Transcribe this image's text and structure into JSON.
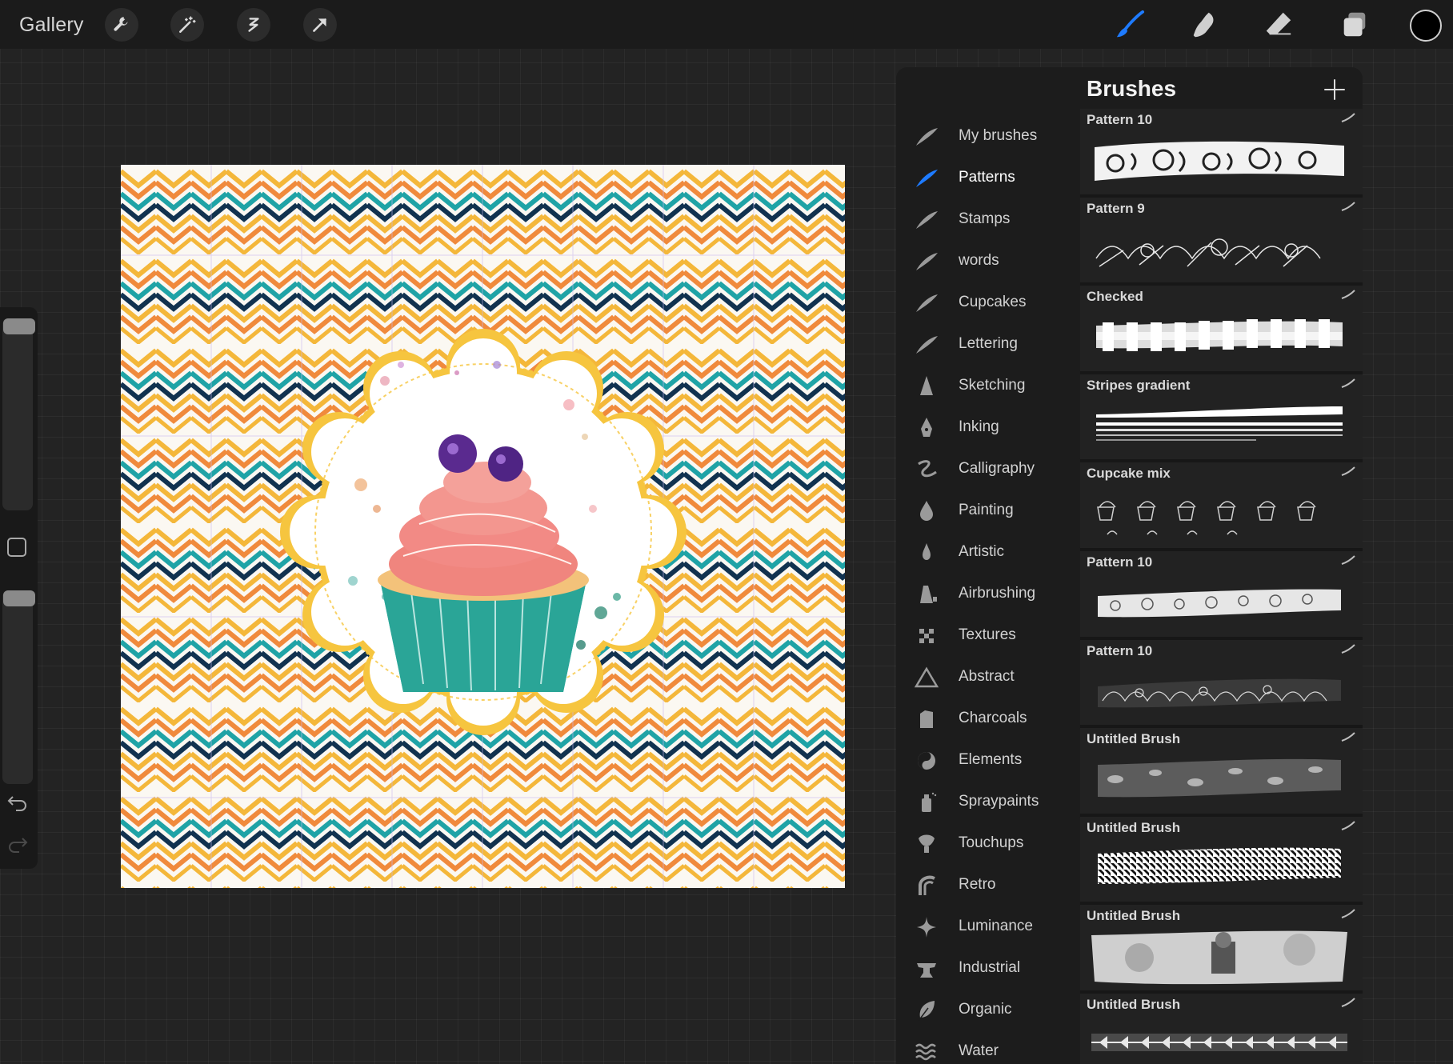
{
  "topbar": {
    "gallery_label": "Gallery",
    "left_tools": [
      "wrench-icon",
      "magic-wand-icon",
      "selection-icon",
      "transform-arrow-icon"
    ],
    "right_tools": [
      "brush-icon",
      "smudge-icon",
      "eraser-icon",
      "layers-icon"
    ],
    "active_tool": "brush-icon",
    "current_color": "#000000"
  },
  "colors": {
    "accent": "#1e7bff",
    "panel": "#1c1c1c",
    "background": "#232323"
  },
  "canvas": {
    "subject": "watercolor cupcake on scalloped label over zigzag chevron pattern",
    "pattern_colors": [
      "#f4b73a",
      "#f08a3c",
      "#1fa3a6",
      "#11324f"
    ]
  },
  "brush_panel": {
    "title": "Brushes",
    "add_icon": "plus-icon",
    "active_set": "Patterns",
    "sets": [
      {
        "label": "My brushes",
        "icon": "feather-icon"
      },
      {
        "label": "Patterns",
        "icon": "feather-icon"
      },
      {
        "label": "Stamps",
        "icon": "feather-icon"
      },
      {
        "label": "words",
        "icon": "feather-icon"
      },
      {
        "label": "Cupcakes",
        "icon": "feather-icon"
      },
      {
        "label": "Lettering",
        "icon": "feather-icon"
      },
      {
        "label": "Sketching",
        "icon": "pencil-tip-icon"
      },
      {
        "label": "Inking",
        "icon": "pen-nib-icon"
      },
      {
        "label": "Calligraphy",
        "icon": "calligraphy-icon"
      },
      {
        "label": "Painting",
        "icon": "paint-drop-icon"
      },
      {
        "label": "Artistic",
        "icon": "flame-drop-icon"
      },
      {
        "label": "Airbrushing",
        "icon": "airbrush-icon"
      },
      {
        "label": "Textures",
        "icon": "checker-icon"
      },
      {
        "label": "Abstract",
        "icon": "triangle-icon"
      },
      {
        "label": "Charcoals",
        "icon": "charcoal-icon"
      },
      {
        "label": "Elements",
        "icon": "yin-yang-icon"
      },
      {
        "label": "Spraypaints",
        "icon": "spray-can-icon"
      },
      {
        "label": "Touchups",
        "icon": "touchup-icon"
      },
      {
        "label": "Retro",
        "icon": "rainbow-icon"
      },
      {
        "label": "Luminance",
        "icon": "sparkle-icon"
      },
      {
        "label": "Industrial",
        "icon": "anvil-icon"
      },
      {
        "label": "Organic",
        "icon": "leaf-icon"
      },
      {
        "label": "Water",
        "icon": "waves-icon"
      }
    ],
    "brushes": [
      {
        "name": "Pattern 10",
        "preview": "swirl"
      },
      {
        "name": "Pattern 9",
        "preview": "doodle"
      },
      {
        "name": "Checked",
        "preview": "checked"
      },
      {
        "name": "Stripes gradient",
        "preview": "stripes"
      },
      {
        "name": "Cupcake mix",
        "preview": "cupcakes"
      },
      {
        "name": "Pattern 10",
        "preview": "lace"
      },
      {
        "name": "Pattern 10",
        "preview": "dark-lace"
      },
      {
        "name": "Untitled Brush",
        "preview": "floral"
      },
      {
        "name": "Untitled Brush",
        "preview": "houndstooth"
      },
      {
        "name": "Untitled Brush",
        "preview": "photo"
      },
      {
        "name": "Untitled Brush",
        "preview": "leaves"
      }
    ]
  }
}
